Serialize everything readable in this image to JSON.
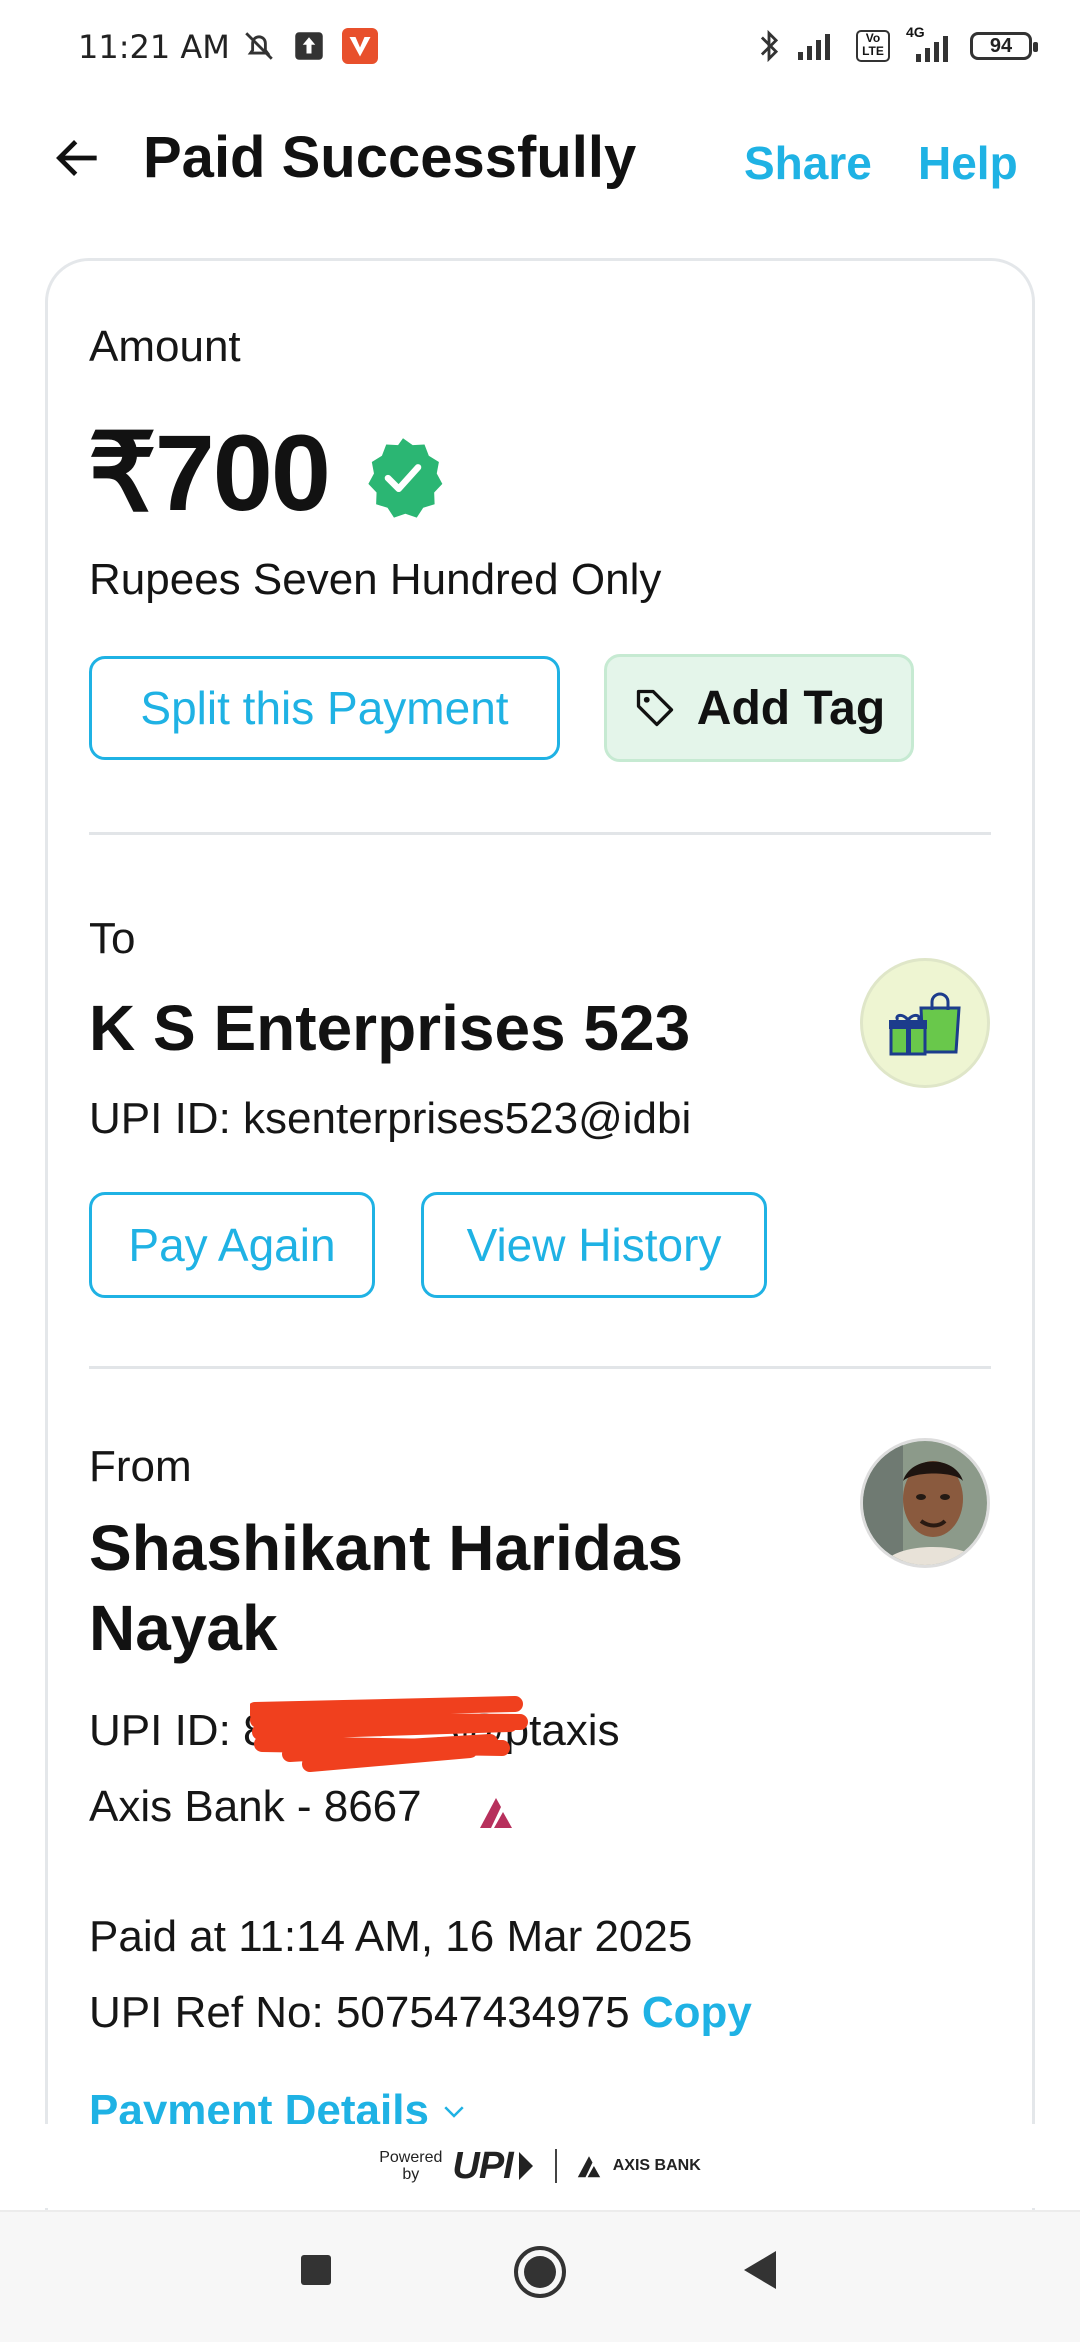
{
  "status_bar": {
    "time": "11:21 AM",
    "battery": "94",
    "network": "4G",
    "volte": "Vo LTE"
  },
  "header": {
    "title": "Paid Successfully",
    "share": "Share",
    "help": "Help"
  },
  "amount_section": {
    "label": "Amount",
    "value": "₹700",
    "in_words": "Rupees Seven Hundred Only",
    "split_button": "Split this Payment",
    "tag_button": "Add Tag"
  },
  "to_section": {
    "label": "To",
    "name": "K S Enterprises 523",
    "upi": "UPI ID: ksenterprises523@idbi",
    "pay_again": "Pay Again",
    "view_history": "View History"
  },
  "from_section": {
    "label": "From",
    "name_line1": "Shashikant Haridas",
    "name_line2": "Nayak",
    "upi_prefix": "UPI ID: 8",
    "upi_suffix": "3@ptaxis",
    "bank": "Axis Bank - 8667"
  },
  "details": {
    "paid_at": "Paid at 11:14 AM, 16 Mar 2025",
    "ref": "UPI Ref No: 507547434975",
    "copy": "Copy",
    "payment_details": "Payment Details"
  },
  "footer": {
    "powered": "Powered",
    "by": "by",
    "upi": "UPI",
    "bank": "AXIS BANK"
  },
  "colors": {
    "accent": "#1fb2e4",
    "verified": "#2bb673",
    "tag_bg": "#e4f5ea"
  }
}
